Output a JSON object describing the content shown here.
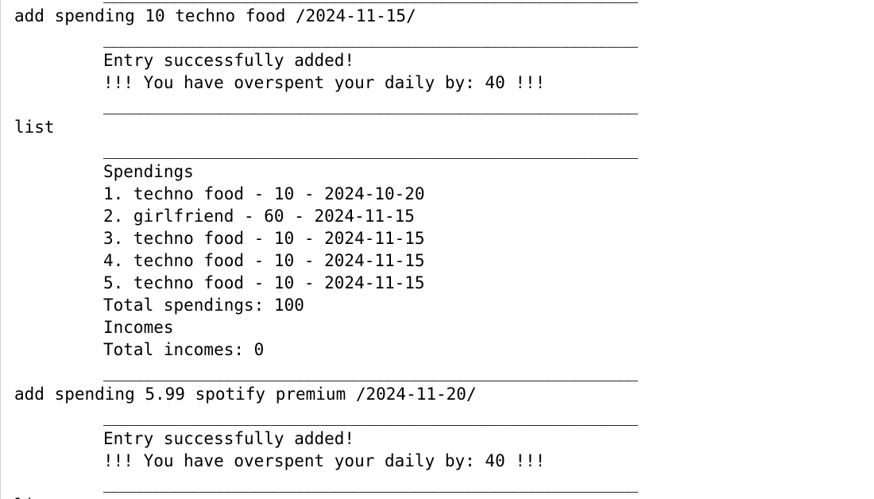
{
  "separator": "____________________________________________________________",
  "blocks": [
    {
      "command": "add spending 10 techno food /2024-11-15/",
      "output": [
        "Entry successfully added!",
        "!!! You have overspent your daily by: 40 !!!"
      ]
    },
    {
      "command": "list",
      "output": [
        "Spendings",
        "1. techno food - 10 - 2024-10-20",
        "2. girlfriend - 60 - 2024-11-15",
        "3. techno food - 10 - 2024-11-15",
        "4. techno food - 10 - 2024-11-15",
        "5. techno food - 10 - 2024-11-15",
        "Total spendings: 100",
        "Incomes",
        "Total incomes: 0"
      ]
    },
    {
      "command": "add spending 5.99 spotify premium /2024-11-20/",
      "output": [
        "Entry successfully added!",
        "!!! You have overspent your daily by: 40 !!!"
      ]
    },
    {
      "command": "li",
      "output": []
    }
  ]
}
